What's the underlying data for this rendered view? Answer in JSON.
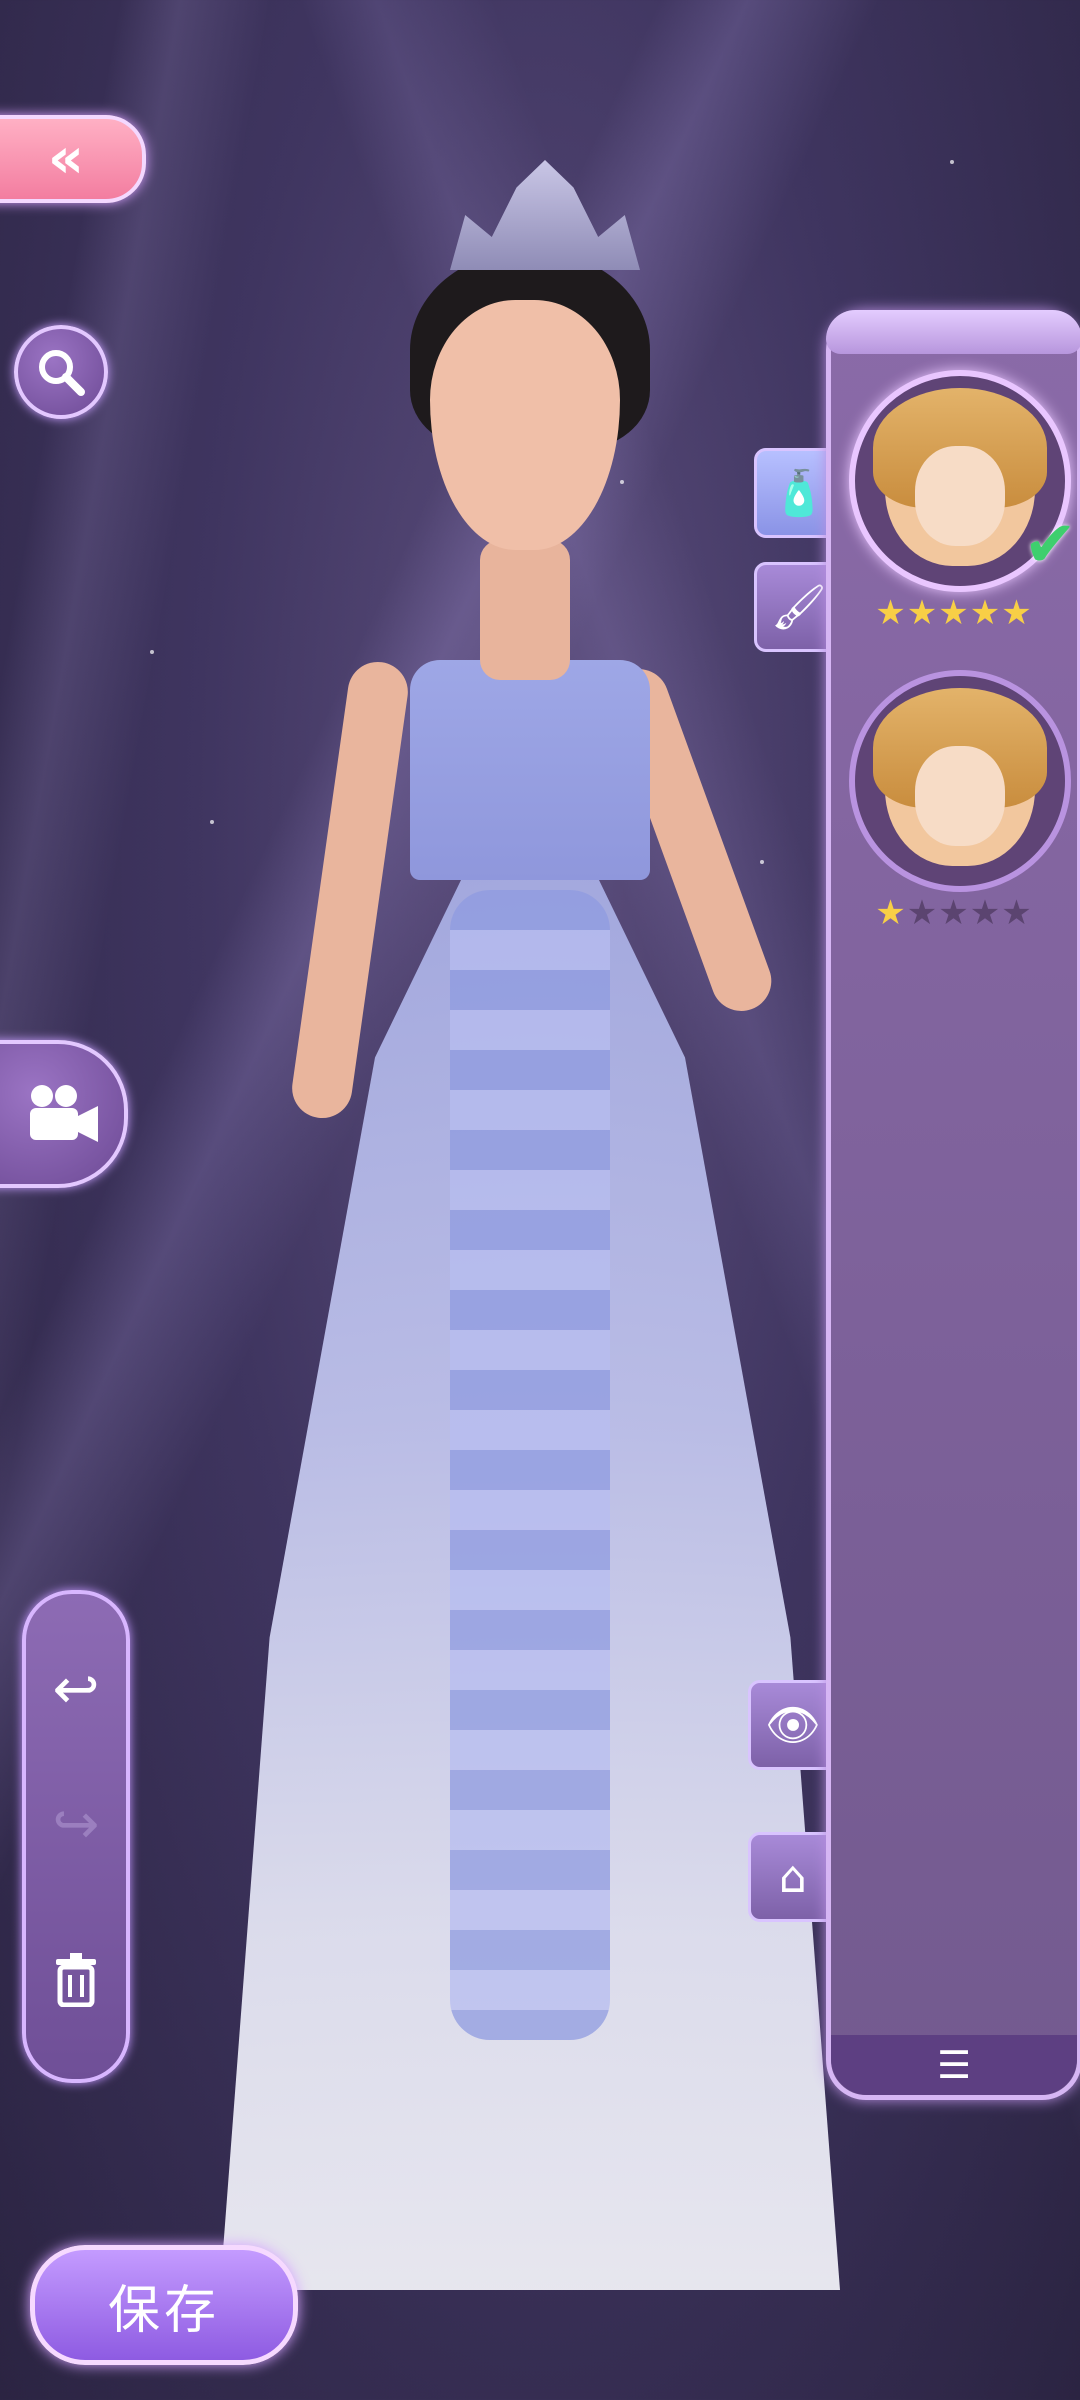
{
  "colors": {
    "background": "#3f3560",
    "accent_purple": "#8e5be2",
    "back_button": "#f37da0",
    "star_on": "#f8cf46",
    "star_off": "#5b4470",
    "check": "#3ecf6e"
  },
  "icons": {
    "back": "double-chevron-left-icon",
    "search": "magnifier-icon",
    "video": "video-camera-icon",
    "undo": "undo-arrow-icon",
    "redo": "redo-arrow-icon",
    "delete": "trash-icon",
    "makeup_tab": "nail-polish-icon",
    "brush_tab": "brush-icon",
    "eye_tab": "eye-icon",
    "hanger_tab": "hanger-icon",
    "panel_menu": "list-icon"
  },
  "items": [
    {
      "rating": 5,
      "max_rating": 5,
      "selected": true
    },
    {
      "rating": 1,
      "max_rating": 5,
      "selected": false
    }
  ],
  "save_label": "保存"
}
